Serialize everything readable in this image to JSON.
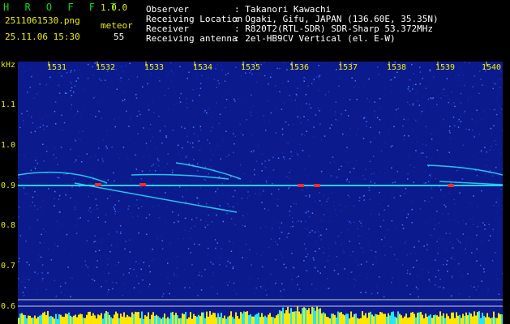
{
  "header": {
    "app_title": "H R O F F T",
    "version": "1.0.0",
    "filename": "2511061530.png",
    "datetime": "25.11.06 15:30",
    "meteor_label": "meteor",
    "meteor_count": "55"
  },
  "station": {
    "observer_label": "Observer",
    "observer_value": ": Takanori Kawachi",
    "location_label": "Receiving Location",
    "location_value": ": Ogaki, Gifu, JAPAN (136.60E, 35.35N)",
    "receiver_label": "Receiver",
    "receiver_value": ": R820T2(RTL-SDR) SDR-Sharp 53.372MHz",
    "antenna_label": "Receiving antenna",
    "antenna_value": ": 2el-HB9CV Vertical (el. E-W)"
  },
  "axis": {
    "y_unit": "kHz",
    "y_ticks": [
      "1.1",
      "1.0",
      "0.9",
      "0.8",
      "0.7",
      "0.6"
    ],
    "x_ticks": [
      "1531",
      "1532",
      "1533",
      "1534",
      "1535",
      "1536",
      "1537",
      "1538",
      "1539",
      "1540"
    ]
  },
  "colors": {
    "background": "#000000",
    "spectrum_bg": "#0b1a8c",
    "title_green": "#00e000",
    "label_yellow": "#f0f000",
    "signal_cyan": "#22e6ff",
    "meteor_red": "#ff2a2a",
    "bottom_yellow": "#ffe600"
  }
}
